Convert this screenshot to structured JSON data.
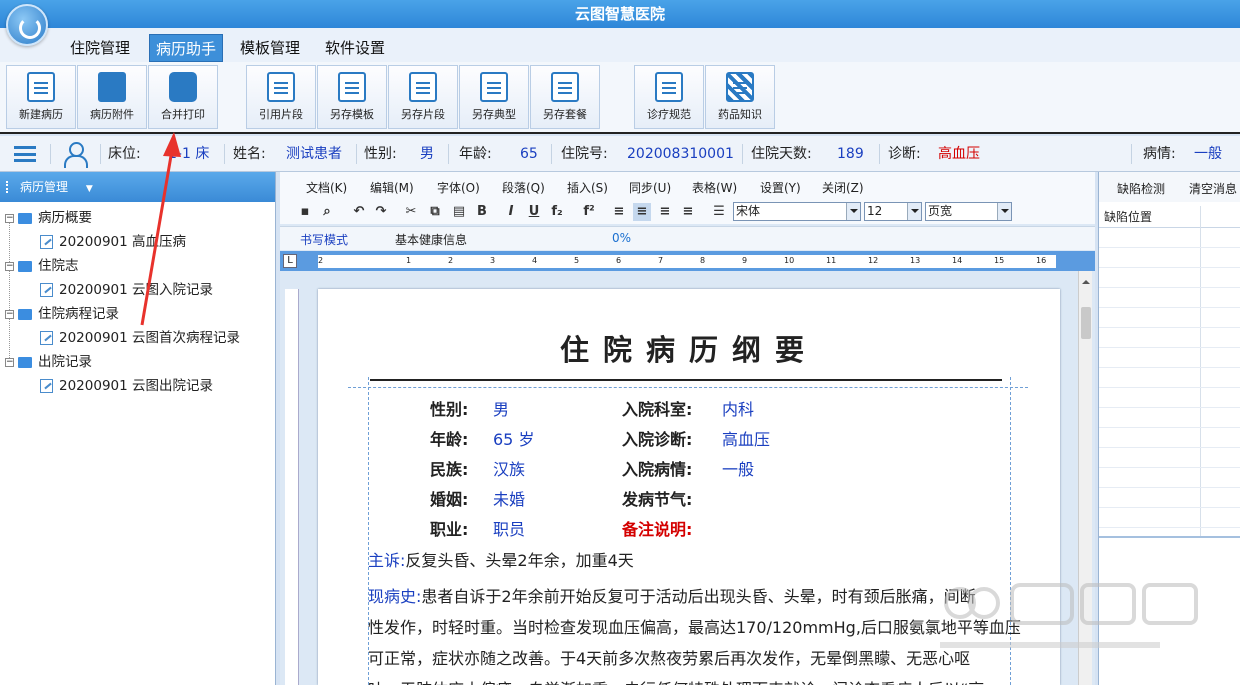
{
  "app": {
    "title": "云图智慧医院"
  },
  "menu": {
    "tabs": [
      "住院管理",
      "病历助手",
      "模板管理",
      "软件设置"
    ],
    "active": 1
  },
  "toolbar": {
    "buttons": [
      "新建病历",
      "病历附件",
      "合并打印",
      "引用片段",
      "另存模板",
      "另存片段",
      "另存典型",
      "另存套餐",
      "诊疗规范",
      "药品知识"
    ]
  },
  "patient": {
    "bed_label": "床位:",
    "bed": "1-1 床",
    "name_label": "姓名:",
    "name": "测试患者",
    "sex_label": "性别:",
    "sex": "男",
    "age_label": "年龄:",
    "age": "65",
    "admission_no_label": "住院号:",
    "admission_no": "202008310001",
    "days_label": "住院天数:",
    "days": "189",
    "diagnosis_label": "诊断:",
    "diagnosis": "高血压",
    "condition_label": "病情:",
    "condition": "一般"
  },
  "left_panel": {
    "header": "病历管理",
    "tree": [
      {
        "label": "病历概要",
        "children": [
          "20200901 高血压病"
        ]
      },
      {
        "label": "住院志",
        "children": [
          "20200901 云图入院记录"
        ]
      },
      {
        "label": "住院病程记录",
        "children": [
          "20200901 云图首次病程记录"
        ]
      },
      {
        "label": "出院记录",
        "children": [
          "20200901 云图出院记录"
        ]
      }
    ]
  },
  "editor": {
    "menu": [
      "文档(K)",
      "编辑(M)",
      "字体(O)",
      "段落(Q)",
      "插入(S)",
      "同步(U)",
      "表格(W)",
      "设置(Y)",
      "关闭(Z)"
    ],
    "font": "宋体",
    "font_size": "12",
    "zoom": "页宽",
    "tabs": [
      "书写模式",
      "基本健康信息"
    ],
    "progress": "0%",
    "ruler_numbers": [
      "1",
      "2",
      "1",
      "2",
      "3",
      "4",
      "5",
      "6",
      "7",
      "8",
      "9",
      "10",
      "11",
      "12",
      "13",
      "14",
      "15",
      "16"
    ]
  },
  "document": {
    "title": "住院病历纲要",
    "fields": {
      "sex_label": "性别:",
      "sex": "男",
      "age_label": "年龄:",
      "age": "65 岁",
      "ethnicity_label": "民族:",
      "ethnicity": "汉族",
      "marriage_label": "婚姻:",
      "marriage": "未婚",
      "job_label": "职业:",
      "job": "职员",
      "dept_label": "入院科室:",
      "dept": "内科",
      "adm_diag_label": "入院诊断:",
      "adm_diag": "高血压",
      "adm_cond_label": "入院病情:",
      "adm_cond": "一般",
      "season_label": "发病节气:",
      "remark_label": "备注说明:"
    },
    "chief_complaint_label": "主诉:",
    "chief_complaint": "反复头昏、头晕2年余，加重4天",
    "hpi_label": "现病史:",
    "hpi_lines": [
      "患者自诉于2年余前开始反复可于活动后出现头昏、头晕，时有颈后胀痛，间断",
      "性发作，时轻时重。当时检查发现血压偏高，最高达170/120mmHg,后口服氨氯地平等血压",
      "可正常，症状亦随之改善。于4天前多次熬夜劳累后再次发作，无晕倒黑矇、无恶心呕",
      "吐，无肢体麻木偏瘫，自觉渐加重，未行任何特殊处理而来就诊，门诊查看病人后以“高"
    ]
  },
  "right_panel": {
    "buttons": [
      "缺陷检测",
      "清空消息"
    ],
    "column": "缺陷位置"
  },
  "colors": {
    "accent": "#2e86d8",
    "value": "#1a3fc0",
    "alert": "#d40000",
    "arrow": "#e8322c"
  }
}
